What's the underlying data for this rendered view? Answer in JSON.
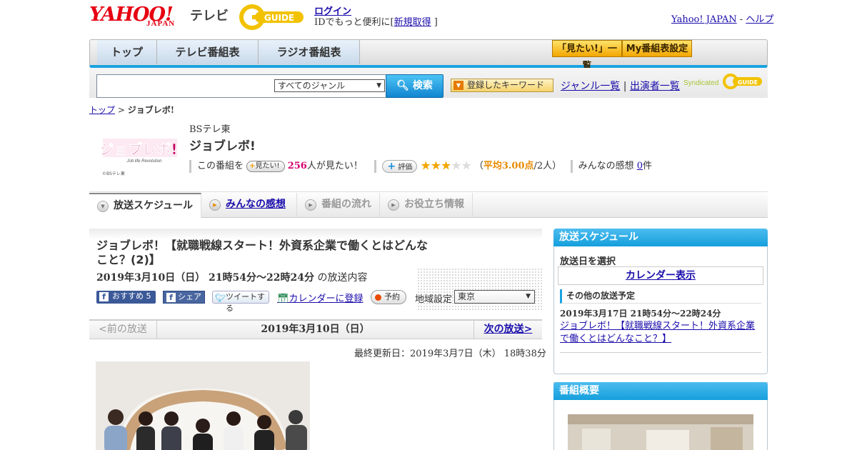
{
  "header": {
    "logo_yahoo": "YAHOO!",
    "logo_japan": "JAPAN",
    "logo_tv": "テレビ",
    "logo_gguide": "G GUIDE",
    "login": "ログイン",
    "login_sub_pre": "IDでもっと便利に[",
    "register": "新規取得",
    "login_sub_post": "]",
    "yahoo_japan": "Yahoo! JAPAN",
    "sep": "-",
    "help": "ヘルプ"
  },
  "nav": {
    "tabs": [
      "トップ",
      "テレビ番組表",
      "ラジオ番組表"
    ],
    "mitai_list": "「見たい!」一覧",
    "my_schedule": "My番組表設定"
  },
  "search": {
    "placeholder": "",
    "genre": "すべてのジャンル",
    "button": "検索",
    "keyword": "登録したキーワード",
    "genre_list": "ジャンル一覧",
    "sep": "|",
    "performers": "出演者一覧",
    "syndicated": "Syndicated",
    "gguide_small": "G GUIDE"
  },
  "breadcrumb": {
    "top": "トップ",
    "sep": ">",
    "current": "ジョブレボ!"
  },
  "program": {
    "logo_text": "ジョブレボ!",
    "logo_sub": "Job life Revolution",
    "logo_caption": "©BSテレ東",
    "station": "BSテレ東",
    "title": "ジョブレボ!",
    "prefix": "この番組を",
    "mitai_btn": "見たい!",
    "mitai_count": "256",
    "mitai_suffix": "人が見たい！",
    "rating_btn": "評価",
    "rating_value": 3,
    "rating_max": 5,
    "rating_open": "（",
    "rating_avg": "平均3.00点",
    "rating_count": "/2人）",
    "impressions_label": "みんなの感想",
    "impressions_count": "0",
    "impressions_unit": "件"
  },
  "tabs": {
    "schedule": "放送スケジュール",
    "impressions": "みんなの感想",
    "flow": "番組の流れ",
    "info": "お役立ち情報"
  },
  "episode": {
    "title": "ジョブレボ！【就職戦線スタート！外資系企業で働くとはどんなこと？(2)】",
    "time": "2019年3月10日（日） 21時54分～22時24分",
    "time_suffix": "の放送内容",
    "fb_like": "おすすめ 5",
    "fb_share": "シェア",
    "tweet": "ツイートする",
    "calendar": "カレンダーに登録",
    "reserve": "予約",
    "region_label": "地域設定",
    "region": "東京",
    "prev": "<前の放送",
    "date": "2019年3月10日（日）",
    "next": "次の放送>",
    "updated": "最終更新日：2019年3月7日（木） 18時38分"
  },
  "sidebar": {
    "schedule_head": "放送スケジュール",
    "select_date": "放送日を選択",
    "calendar": "カレンダー表示",
    "other_head": "その他の放送予定",
    "other_time": "2019年3月17日 21時54分～22時24分",
    "other_link": "ジョブレボ！【就職戦線スタート！外資系企業で働くとはどんなこと？】",
    "overview_head": "番組概要"
  }
}
